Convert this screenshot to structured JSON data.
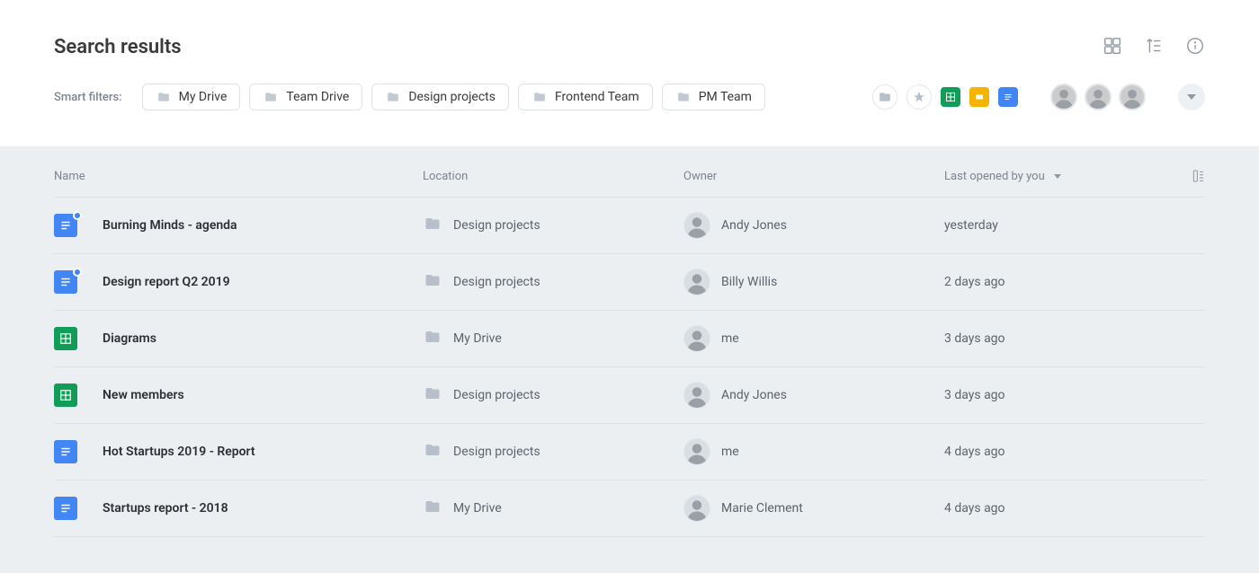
{
  "header": {
    "title": "Search results",
    "smart_filters_label": "Smart filters:",
    "location_chips": [
      {
        "label": "My Drive"
      },
      {
        "label": "Team Drive"
      },
      {
        "label": "Design projects"
      },
      {
        "label": "Frontend Team"
      },
      {
        "label": "PM Team"
      }
    ],
    "type_filters": [
      "folder",
      "star",
      "sheets",
      "slides",
      "docs"
    ]
  },
  "table": {
    "columns": {
      "name": "Name",
      "location": "Location",
      "owner": "Owner",
      "last_opened": "Last opened by you"
    },
    "rows": [
      {
        "name": "Burning Minds - agenda",
        "type": "doc",
        "badge": true,
        "location": "Design projects",
        "owner": "Andy Jones",
        "last_opened": "yesterday"
      },
      {
        "name": "Design report Q2 2019",
        "type": "doc",
        "badge": true,
        "location": "Design projects",
        "owner": "Billy Willis",
        "last_opened": "2 days ago"
      },
      {
        "name": "Diagrams",
        "type": "sheet",
        "badge": false,
        "location": "My Drive",
        "owner": "me",
        "last_opened": "3 days ago"
      },
      {
        "name": "New members",
        "type": "sheet",
        "badge": false,
        "location": "Design projects",
        "owner": "Andy Jones",
        "last_opened": "3 days ago"
      },
      {
        "name": "Hot Startups 2019 - Report",
        "type": "doc",
        "badge": false,
        "location": "Design projects",
        "owner": "me",
        "last_opened": "4 days ago"
      },
      {
        "name": "Startups report - 2018",
        "type": "doc",
        "badge": false,
        "location": "My Drive",
        "owner": "Marie Clement",
        "last_opened": "4 days ago"
      }
    ]
  }
}
